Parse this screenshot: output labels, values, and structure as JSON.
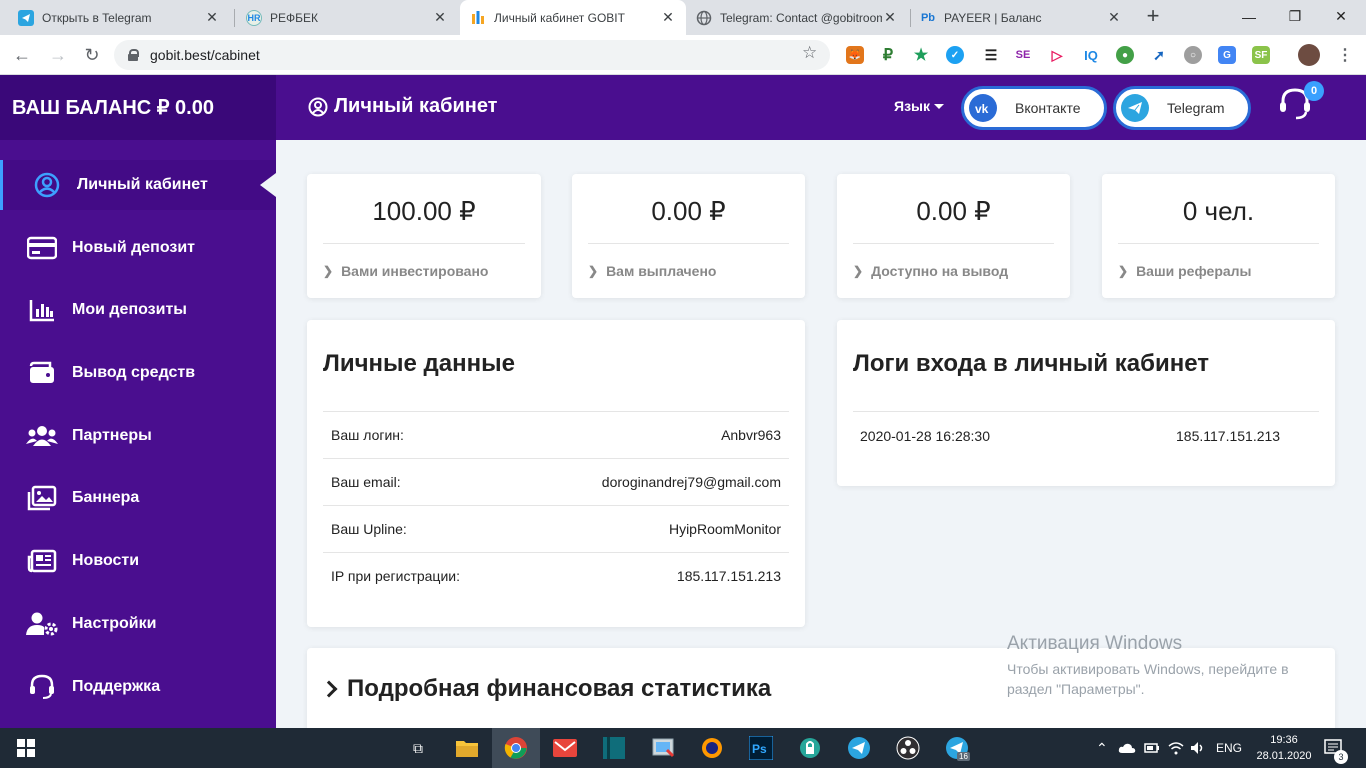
{
  "browser": {
    "tabs": [
      {
        "title": "Открыть в Telegram",
        "icon": "telegram-icon",
        "color": "#2ca5e0",
        "active": false
      },
      {
        "title": "РЕФБЕК",
        "icon": "hr-icon",
        "color": "#1e88e5",
        "active": false
      },
      {
        "title": "Личный кабинет GOBIT",
        "icon": "gobit-icon",
        "color": "#f5a623",
        "active": true
      },
      {
        "title": "Telegram: Contact @gobitroom",
        "icon": "globe-icon",
        "color": "#5f6368",
        "active": false
      },
      {
        "title": "PAYEER | Баланс",
        "icon": "payeer-icon",
        "color": "#1976d2",
        "active": false
      }
    ],
    "url": "gobit.best/cabinet",
    "window_controls": [
      "—",
      "❐",
      "✕"
    ]
  },
  "sidebar": {
    "balance": "ВАШ БАЛАНС ₽ 0.00",
    "items": [
      {
        "label": "Личный кабинет",
        "icon": "user-circle-icon",
        "active": true
      },
      {
        "label": "Новый депозит",
        "icon": "credit-card-icon",
        "active": false
      },
      {
        "label": "Мои депозиты",
        "icon": "bar-chart-icon",
        "active": false
      },
      {
        "label": "Вывод средств",
        "icon": "wallet-icon",
        "active": false
      },
      {
        "label": "Партнеры",
        "icon": "users-icon",
        "active": false
      },
      {
        "label": "Баннера",
        "icon": "images-icon",
        "active": false
      },
      {
        "label": "Новости",
        "icon": "newspaper-icon",
        "active": false
      },
      {
        "label": "Настройки",
        "icon": "user-cog-icon",
        "active": false
      },
      {
        "label": "Поддержка",
        "icon": "headset-icon",
        "active": false
      }
    ]
  },
  "header": {
    "title": "Личный кабинет",
    "language_label": "Язык",
    "vk_label": "Вконтакте",
    "telegram_label": "Telegram",
    "support_badge": "0"
  },
  "stats": [
    {
      "value": "100.00 ₽",
      "label": "Вами инвестировано"
    },
    {
      "value": "0.00 ₽",
      "label": "Вам выплачено"
    },
    {
      "value": "0.00 ₽",
      "label": "Доступно на вывод"
    },
    {
      "value": "0 чел.",
      "label": "Ваши рефералы"
    }
  ],
  "personal": {
    "title": "Личные данные",
    "rows": [
      {
        "label": "Ваш логин:",
        "value": "Anbvr963"
      },
      {
        "label": "Ваш email:",
        "value": "doroginandrej79@gmail.com"
      },
      {
        "label": "Ваш Upline:",
        "value": "HyipRoomMonitor"
      },
      {
        "label": "IP при регистрации:",
        "value": "185.117.151.213"
      }
    ]
  },
  "logins": {
    "title": "Логи входа в личный кабинет",
    "rows": [
      {
        "datetime": "2020-01-28 16:28:30",
        "ip": "185.117.151.213"
      }
    ]
  },
  "finance": {
    "title": "Подробная финансовая статистика"
  },
  "watermark": {
    "line1": "Активация Windows",
    "line2": "Чтобы активировать Windows, перейдите в раздел \"Параметры\"."
  },
  "taskbar": {
    "lang": "ENG",
    "time": "19:36",
    "date": "28.01.2020",
    "notifications": "3",
    "telegram_badge": "16"
  },
  "colors": {
    "sidebar": "#4a0e8f",
    "accent": "#3da0ff",
    "page_bg": "#f0f4f8"
  }
}
